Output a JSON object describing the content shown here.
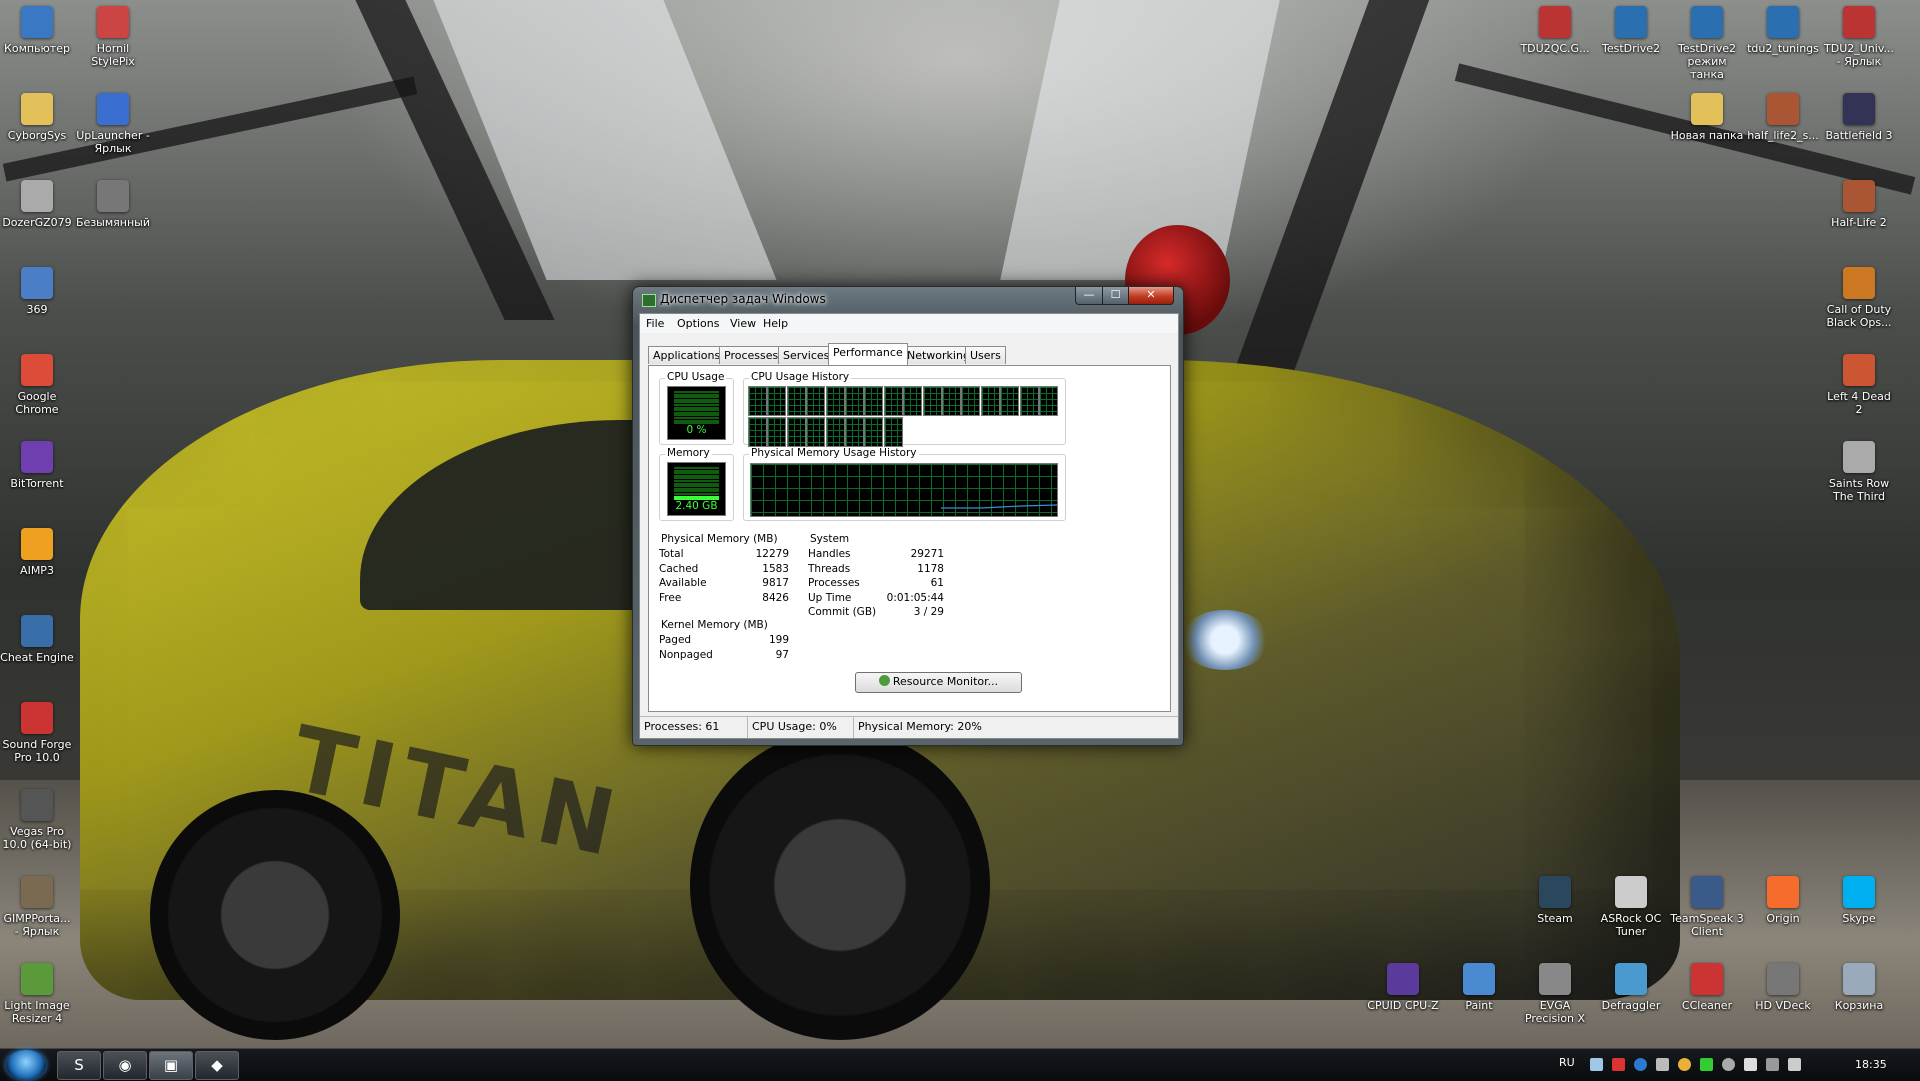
{
  "window": {
    "title": "Диспетчер задач Windows",
    "buttons": {
      "minimize": "—",
      "maximize": "☐",
      "close": "✕"
    }
  },
  "menu": [
    "File",
    "Options",
    "View",
    "Help"
  ],
  "tabs": [
    "Applications",
    "Processes",
    "Services",
    "Performance",
    "Networking",
    "Users"
  ],
  "active_tab": "Performance",
  "performance": {
    "cpu_usage_label": "CPU Usage",
    "cpu_usage_value": "0 %",
    "cpu_history_label": "CPU Usage History",
    "memory_label": "Memory",
    "memory_value": "2.40 GB",
    "memory_history_label": "Physical Memory Usage History",
    "physical_memory": {
      "label": "Physical Memory (MB)",
      "rows": [
        {
          "name": "Total",
          "value": "12279"
        },
        {
          "name": "Cached",
          "value": "1583"
        },
        {
          "name": "Available",
          "value": "9817"
        },
        {
          "name": "Free",
          "value": "8426"
        }
      ]
    },
    "kernel_memory": {
      "label": "Kernel Memory (MB)",
      "rows": [
        {
          "name": "Paged",
          "value": "199"
        },
        {
          "name": "Nonpaged",
          "value": "97"
        }
      ]
    },
    "system": {
      "label": "System",
      "rows": [
        {
          "name": "Handles",
          "value": "29271"
        },
        {
          "name": "Threads",
          "value": "1178"
        },
        {
          "name": "Processes",
          "value": "61"
        },
        {
          "name": "Up Time",
          "value": "0:01:05:44"
        },
        {
          "name": "Commit (GB)",
          "value": "3 / 29"
        }
      ]
    },
    "resource_monitor_button": "Resource Monitor..."
  },
  "status_bar": {
    "processes": "Processes: 61",
    "cpu": "CPU Usage: 0%",
    "memory": "Physical Memory: 20%"
  },
  "desktop_icons_left": [
    {
      "label": "Компьютер",
      "icon": "computer-icon"
    },
    {
      "label": "Hornil StylePix",
      "icon": "stylepix-icon"
    },
    {
      "label": "CyborgSys",
      "icon": "folder-icon"
    },
    {
      "label": "UpLauncher - Ярлык",
      "icon": "uplauncher-icon"
    },
    {
      "label": "DozerGZ079",
      "icon": "file-icon"
    },
    {
      "label": "Безымянный",
      "icon": "image-icon"
    },
    {
      "label": "369",
      "icon": "shortcut-icon"
    },
    {
      "label": "Google Chrome",
      "icon": "chrome-icon"
    },
    {
      "label": "BitTorrent",
      "icon": "bittorrent-icon"
    },
    {
      "label": "AIMP3",
      "icon": "aimp-icon"
    },
    {
      "label": "Cheat Engine",
      "icon": "cheat-engine-icon"
    },
    {
      "label": "Sound Forge Pro 10.0",
      "icon": "sound-forge-icon"
    },
    {
      "label": "Vegas Pro 10.0 (64-bit)",
      "icon": "vegas-icon"
    },
    {
      "label": "GIMPPorta... - Ярлык",
      "icon": "gimp-icon"
    },
    {
      "label": "Light Image Resizer 4",
      "icon": "image-resizer-icon"
    }
  ],
  "desktop_icons_right": [
    {
      "label": "TDU2QC.G...",
      "icon": "tdu-icon"
    },
    {
      "label": "TestDrive2",
      "icon": "testdrive-icon"
    },
    {
      "label": "TestDrive2 режим танка",
      "icon": "testdrive-icon"
    },
    {
      "label": "tdu2_tunings",
      "icon": "testdrive-icon"
    },
    {
      "label": "TDU2_Univ... - Ярлык",
      "icon": "tdu-icon"
    },
    {
      "label": "Новая папка",
      "icon": "folder-icon"
    },
    {
      "label": "half_life2_s...",
      "icon": "halflife-icon"
    },
    {
      "label": "Battlefield 3",
      "icon": "battlefield-icon"
    },
    {
      "label": "Half-Life 2",
      "icon": "halflife-icon"
    },
    {
      "label": "Call of Duty Black Ops...",
      "icon": "cod-icon"
    },
    {
      "label": "Left 4 Dead 2",
      "icon": "l4d-icon"
    },
    {
      "label": "Saints Row The Third",
      "icon": "saints-row-icon"
    }
  ],
  "desktop_icons_bottom": [
    {
      "label": "Steam",
      "icon": "steam-icon"
    },
    {
      "label": "ASRock OC Tuner",
      "icon": "asrock-icon"
    },
    {
      "label": "TeamSpeak 3 Client",
      "icon": "teamspeak-icon"
    },
    {
      "label": "Origin",
      "icon": "origin-icon"
    },
    {
      "label": "Skype",
      "icon": "skype-icon"
    },
    {
      "label": "CPUID CPU-Z",
      "icon": "cpuz-icon"
    },
    {
      "label": "Paint",
      "icon": "paint-icon"
    },
    {
      "label": "EVGA Precision X",
      "icon": "evga-icon"
    },
    {
      "label": "Defraggler",
      "icon": "defraggler-icon"
    },
    {
      "label": "CCleaner",
      "icon": "ccleaner-icon"
    },
    {
      "label": "HD VDeck",
      "icon": "hdvdeck-icon"
    },
    {
      "label": "Корзина",
      "icon": "recycle-bin-icon"
    }
  ],
  "taskbar": {
    "language": "RU",
    "clock": "18:35",
    "pinned": [
      {
        "icon": "skype-icon",
        "glyph": "S"
      },
      {
        "icon": "chrome-icon",
        "glyph": "◉"
      },
      {
        "icon": "taskmgr-icon",
        "glyph": "▣"
      },
      {
        "icon": "car-icon",
        "glyph": "◆"
      }
    ]
  },
  "colors": {
    "meter_green": "#38ff38",
    "grid_green": "#0b6b2a",
    "memory_line": "#3a8fd8",
    "close_red": "#c13b23"
  }
}
